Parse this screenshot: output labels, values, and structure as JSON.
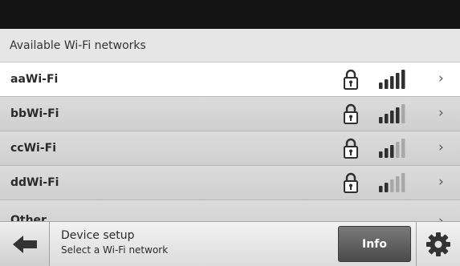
{
  "header": {
    "title": "Available Wi-Fi networks"
  },
  "networks": [
    {
      "name": "aaWi-Fi",
      "signal_bars": 5,
      "secured": true,
      "selected": true
    },
    {
      "name": "bbWi-Fi",
      "signal_bars": 4,
      "secured": true,
      "selected": false
    },
    {
      "name": "ccWi-Fi",
      "signal_bars": 3,
      "secured": true,
      "selected": false
    },
    {
      "name": "ddWi-Fi",
      "signal_bars": 2,
      "secured": true,
      "selected": false
    },
    {
      "name": "Other",
      "secured": false,
      "selected": false
    }
  ],
  "icons": {
    "lock": "lock-icon",
    "signal": "wifi-signal-icon",
    "chevron": "chevron-right-icon",
    "back": "arrow-left-icon",
    "settings": "gear-icon"
  },
  "chevron_glyph": "›",
  "footer": {
    "title": "Device setup",
    "subtitle": "Select a Wi-Fi network",
    "info_label": "Info"
  },
  "colors": {
    "topbar": "#141414",
    "signal_active": "#2f2f2f",
    "signal_inactive": "#a8a8a8",
    "info_button": "#5a5a5a"
  }
}
